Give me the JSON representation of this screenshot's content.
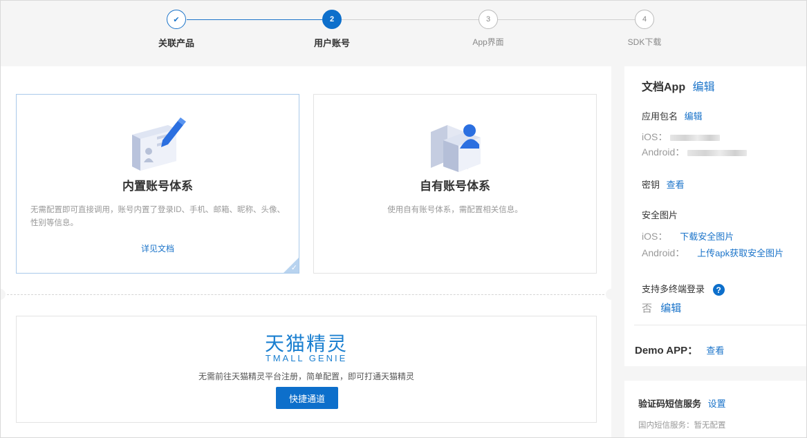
{
  "steps": [
    {
      "num": "✔",
      "label": "关联产品",
      "state": "done"
    },
    {
      "num": "2",
      "label": "用户账号",
      "state": "active"
    },
    {
      "num": "3",
      "label": "App界面",
      "state": "todo"
    },
    {
      "num": "4",
      "label": "SDK下载",
      "state": "todo"
    }
  ],
  "cards": {
    "builtin": {
      "title": "内置账号体系",
      "desc": "无需配置即可直接调用，账号内置了登录ID、手机、邮箱、昵称、头像、性别等信息。",
      "link": "详见文档"
    },
    "own": {
      "title": "自有账号体系",
      "desc": "使用自有账号体系，需配置相关信息。"
    }
  },
  "genie": {
    "brand": "天猫精灵",
    "brand_en": "TMALL GENIE",
    "desc": "无需前往天猫精灵平台注册，简单配置，即可打通天猫精灵",
    "button": "快捷通道"
  },
  "side": {
    "app_name": "文档App",
    "edit": "编辑",
    "package_label": "应用包名",
    "ios_label": "iOS：",
    "android_label": "Android：",
    "secret_label": "密钥",
    "view": "查看",
    "security_label": "安全图片",
    "ios_sec_label": "iOS：",
    "ios_sec_link": "下载安全图片",
    "android_sec_label": "Android：",
    "android_sec_link": "上传apk获取安全图片",
    "multi_login_label": "支持多终端登录",
    "multi_login_value": "否",
    "demo_label": "Demo APP：",
    "sms_label": "验证码短信服务",
    "sms_setting": "设置",
    "sms_status": "国内短信服务：暂无配置"
  },
  "colors": {
    "accent": "#0d6fcb",
    "link": "#1a73c9",
    "muted": "#999999"
  }
}
